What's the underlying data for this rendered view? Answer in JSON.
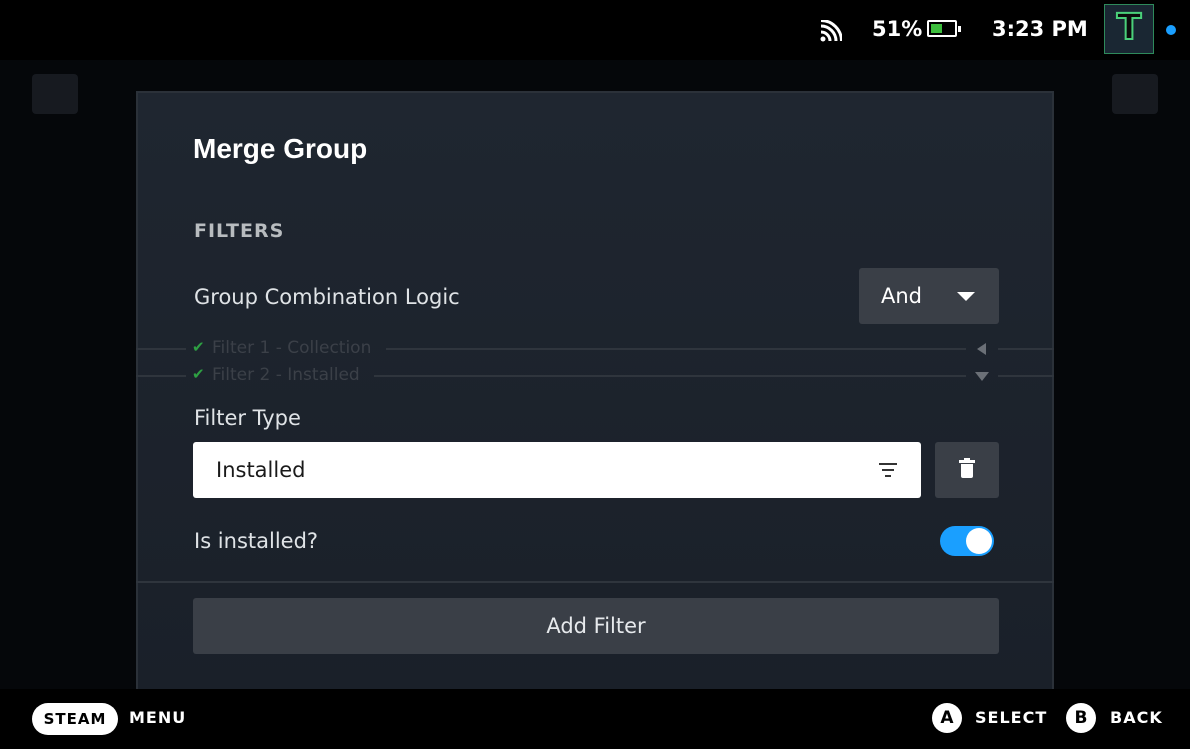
{
  "status_bar": {
    "battery_percent": "51%",
    "battery_level": 0.51,
    "time": "3:23 PM",
    "avatar_letter": "T",
    "colors": {
      "battery_fill": "#3dbd3d",
      "notification_dot": "#1a9fff"
    }
  },
  "modal": {
    "title": "Merge Group",
    "section_label": "FILTERS",
    "logic": {
      "label": "Group Combination Logic",
      "selected": "And"
    },
    "filters": [
      {
        "label": "Filter 1 - Collection",
        "expanded": false
      },
      {
        "label": "Filter 2 - Installed",
        "expanded": true
      }
    ],
    "filter_type": {
      "label": "Filter Type",
      "value": "Installed"
    },
    "installed": {
      "label": "Is installed?",
      "checked": true
    },
    "add_filter_label": "Add Filter"
  },
  "footer": {
    "steam_label": "STEAM",
    "menu_label": "MENU",
    "select_key": "A",
    "select_label": "SELECT",
    "back_key": "B",
    "back_label": "BACK"
  },
  "colors": {
    "accent": "#1a9fff",
    "modal_bg": "#1c222c",
    "button_bg": "#3a3f47",
    "check_green": "#2ea043"
  },
  "icons": [
    "wifi-icon",
    "battery-icon",
    "chevron-down-icon",
    "collapse-left-icon",
    "expand-down-icon",
    "filter-lines-icon",
    "trash-icon",
    "check-icon"
  ]
}
